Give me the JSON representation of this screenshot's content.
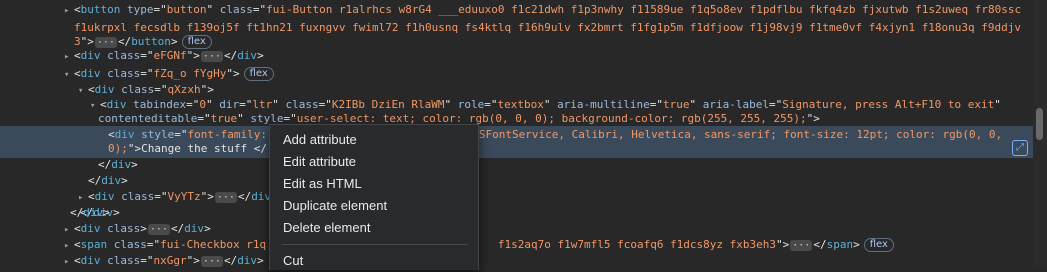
{
  "elements": {
    "lines": [
      {
        "indent": 0,
        "tri": "▸",
        "html": "&lt;<span class='t'>button</span> <span class='a'>type</span>=\"<span class='v'>button</span>\" <span class='a'>class</span>=\"<span class='v'>fui-Button r1alrhcs w8rG4 ___eduuxo0 f1c21dwh f1p3nwhy f11589ue f1q5o8ev f1pdflbu fkfq4zb fjxutwb f1s2uweq fr80ssc</span>"
      },
      {
        "indent": 1,
        "tri": "",
        "html": "<span class='v'>f1ukrpxl fecsdlb f139oj5f ft1hn21 fuxngvv fwiml72 f1h0usnq fs4ktlq f16h9ulv fx2bmrt f1fg1p5m f1dfjoow f1j98vj9 f1tme0vf f4xjyn1 f18onu3q f9ddjv</span>"
      },
      {
        "indent": 1,
        "tri": "",
        "html": "<span class='v'>3</span>\"&gt;<span class='dots'>···</span>&lt;/<span class='t'>button</span>&gt;<span class='badge'>flex</span>"
      },
      {
        "indent": 0,
        "tri": "▸",
        "html": "&lt;<span class='t'>div</span> <span class='a'>class</span>=\"<span class='v'>eFGNf</span>\"&gt;<span class='dots'>···</span>&lt;/<span class='t'>div</span>&gt;"
      },
      {
        "indent": 0,
        "tri": "▾",
        "html": "&lt;<span class='t'>div</span> <span class='a'>class</span>=\"<span class='v'>fZq_o fYgHy</span>\"&gt;<span class='badge'>flex</span>"
      },
      {
        "indent": 1,
        "tri": "▾",
        "html": "&lt;<span class='t'>div</span> <span class='a'>class</span>=\"<span class='v'>qXzxh</span>\"&gt;"
      },
      {
        "indent": 2,
        "tri": "▾",
        "html": "&lt;<span class='t'>div</span> <span class='a'>tabindex</span>=\"<span class='v'>0</span>\" <span class='a'>dir</span>=\"<span class='v'>ltr</span>\" <span class='a'>class</span>=\"<span class='v'>K2IBb DziEn RlaWM</span>\" <span class='a'>role</span>=\"<span class='v'>textbox</span>\" <span class='a'>aria-multiline</span>=\"<span class='v'>true</span>\" <span class='a'>aria-label</span>=\"<span class='v'>Signature, press Alt+F10 to exit</span>\""
      },
      {
        "indent": 2,
        "tri": "",
        "html": "<span class='a'>contenteditable</span>=\"<span class='v'>true</span>\" <span class='a'>style</span>=\"<span class='v'>user-select: text; color: rgb(0, 0, 0); background-color: rgb(255, 255, 255);</span>\"&gt;"
      },
      {
        "indent": 3,
        "tri": "",
        "html": "&lt;<span class='t'>div</span> <span class='a'>style</span>=\"<span class='v'>font-family:                             s_MSFontService, Calibri, Helvetica, sans-serif; font-size: 12pt; color: rgb(0, 0,</span>"
      },
      {
        "indent": 3,
        "tri": "",
        "html": "<span class='v'>0);</span>\"&gt;<span class='tx'>Change the stuff</span> &lt;/"
      },
      {
        "indent": 3,
        "tri": "",
        "html": "&lt;/<span class='t'>div</span>&gt;"
      },
      {
        "indent": 2,
        "tri": "",
        "html": "&lt;/<span class='t'>div</span>&gt;"
      },
      {
        "indent": 2,
        "tri": "▸",
        "html": "&lt;<span class='t'>div</span> <span class='a'>class</span>=\"<span class='v'>VyYTz</span>\"&gt;<span class='dots'>···</span>&lt;/<span class='t'>div</span>&gt;"
      },
      {
        "indent": 1,
        "tri": "",
        "html": "&lt;/<span class='t'>div</span>&gt;"
      },
      {
        "indent": 0,
        "tri": "",
        "html": "&lt;/<span class='t'>div</span>&gt;"
      },
      {
        "indent": 0,
        "tri": "▸",
        "html": "&lt;<span class='t'>div</span> <span class='a'>class</span>&gt;<span class='dots'>···</span>&lt;/<span class='t'>div</span>&gt;"
      },
      {
        "indent": 0,
        "tri": "▸",
        "html": "&lt;<span class='t'>span</span> <span class='a'>class</span>=\"<span class='v'>fui-Checkbox r1q                                   f1s2aq7o f1w7mfl5 fcoafq6 f1dcs8yz fxb3eh3</span>\"&gt;<span class='dots'>···</span>&lt;/<span class='t'>span</span>&gt;<span class='badge'>flex</span>"
      },
      {
        "indent": 0,
        "tri": "▸",
        "html": "&lt;<span class='t'>div</span> <span class='a'>class</span>=\"<span class='v'>nxGgr</span>\"&gt;<span class='dots'>···</span>&lt;/<span class='t'>div</span>&gt;"
      }
    ],
    "context_menu": [
      "Add attribute",
      "Edit attribute",
      "Edit as HTML",
      "Duplicate element",
      "Delete element",
      "Cut"
    ]
  }
}
